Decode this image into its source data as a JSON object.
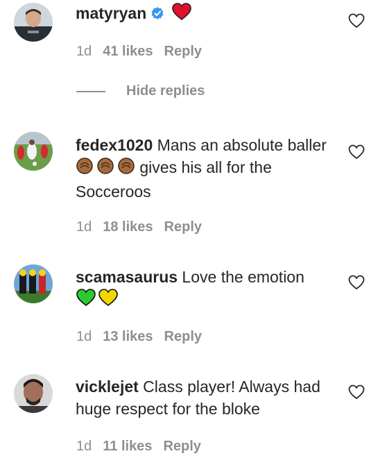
{
  "comments": [
    {
      "username": "matyryan",
      "text": "",
      "time": "1d",
      "likes": "41 likes",
      "reply": "Reply",
      "verified": true
    },
    {
      "username": "fedex1020",
      "text": " Mans an absolute baller ",
      "text_after": " gives his all for the Socceroos",
      "time": "1d",
      "likes": "18 likes",
      "reply": "Reply"
    },
    {
      "username": "scamasaurus",
      "text": " Love the emotion",
      "time": "1d",
      "likes": "13 likes",
      "reply": "Reply"
    },
    {
      "username": "vicklejet",
      "text": " Class player! Always had huge respect for the bloke",
      "time": "1d",
      "likes": "11 likes",
      "reply": "Reply"
    }
  ],
  "hide_replies": "Hide replies",
  "icons": {
    "verified": "verified-badge-icon",
    "red_heart": "red-heart-emoji",
    "clap": "clapping-hands-emoji",
    "green_heart": "green-heart-emoji",
    "yellow_heart": "yellow-heart-emoji",
    "like": "heart-outline-icon"
  },
  "colors": {
    "text": "#262626",
    "muted": "#8e8e8e",
    "verified": "#3897f0",
    "red_heart": "#e0112b",
    "green_heart": "#2ec92e",
    "yellow_heart": "#f2d600"
  }
}
